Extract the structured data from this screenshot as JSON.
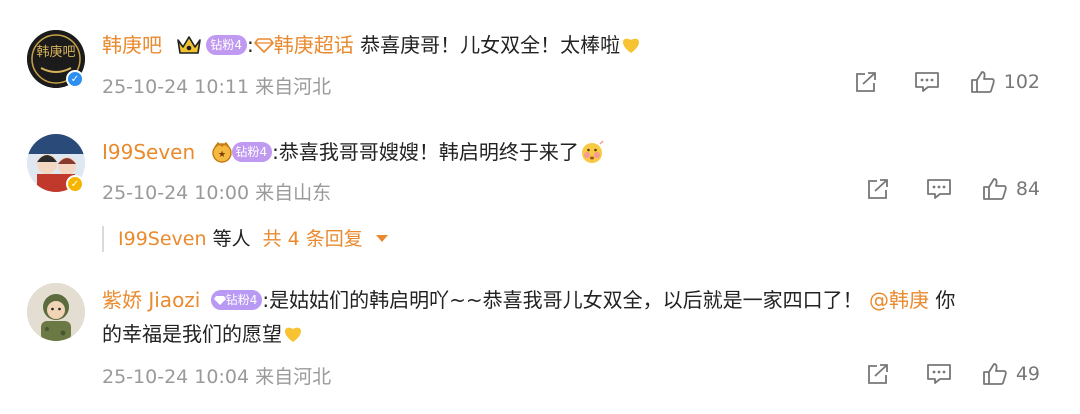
{
  "colors": {
    "username": "#ea8a2e",
    "fan_badge_orange": "#c69cf2",
    "fan_badge_purple": "#b89af5",
    "meta": "#9a9a9a",
    "reply_more": "#ea8a2e",
    "verified_blue": "#2d8ff0",
    "verified_gold": "#f6b500"
  },
  "comments": [
    {
      "avatar_text": "韩庚吧",
      "username": "韩庚吧",
      "fan_badge": "钻粉4",
      "separator": ":",
      "topic_link": "韩庚超话",
      "body": "恭喜庚哥！儿女双全！太棒啦",
      "emoji_icon": "yellow-heart-icon",
      "time": "25-10-24 10:11",
      "location": "来自河北",
      "like_count": "102"
    },
    {
      "username": "I99Seven",
      "fan_badge": "钻粉4",
      "separator": ":",
      "body": "恭喜我哥哥嫂嫂！韩启明终于来了",
      "emoji_icon": "blushing-face-icon",
      "time": "25-10-24 10:00",
      "location": "来自山东",
      "like_count": "84",
      "replies": {
        "user": "I99Seven",
        "others": "等人",
        "count_text": "共 4 条回复"
      }
    },
    {
      "username": "紫娇 Jiaozi",
      "fan_badge": "钻粉4",
      "separator": ":",
      "body_line1": "是姑姑们的韩启明吖~~恭喜我哥儿女双全，以后就是一家四口了！",
      "mention": "@韩庚",
      "body_line1_end": "你",
      "body_line2": "的幸福是我们的愿望",
      "emoji_icon": "yellow-heart-icon",
      "time": "25-10-24 10:04",
      "location": "来自河北",
      "like_count": "49"
    }
  ]
}
